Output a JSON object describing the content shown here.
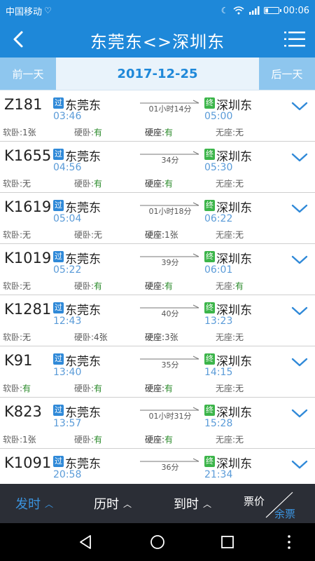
{
  "status": {
    "carrier": "中国移动",
    "time": "00:06"
  },
  "header": {
    "title": "东莞东<>深圳东"
  },
  "datebar": {
    "prev_label": "前一天",
    "date": "2017-12-25",
    "next_label": "后一天"
  },
  "trains": [
    {
      "num": "Z181",
      "from": "东莞东",
      "dep": "03:46",
      "duration": "01小时14分",
      "to": "深圳东",
      "arr": "05:00",
      "seats": [
        {
          "label": "软卧:",
          "val": "1张",
          "avail": false
        },
        {
          "label": "硬卧:",
          "val": "有",
          "avail": true
        },
        {
          "label": "硬座:",
          "val": "有",
          "avail": true
        },
        {
          "label": "无座:",
          "val": "无",
          "avail": false
        }
      ]
    },
    {
      "num": "K1655",
      "from": "东莞东",
      "dep": "04:56",
      "duration": "34分",
      "to": "深圳东",
      "arr": "05:30",
      "seats": [
        {
          "label": "软卧:",
          "val": "无",
          "avail": false
        },
        {
          "label": "硬卧:",
          "val": "有",
          "avail": true
        },
        {
          "label": "硬座:",
          "val": "有",
          "avail": true
        },
        {
          "label": "无座:",
          "val": "无",
          "avail": false
        }
      ]
    },
    {
      "num": "K1619",
      "from": "东莞东",
      "dep": "05:04",
      "duration": "01小时18分",
      "to": "深圳东",
      "arr": "06:22",
      "seats": [
        {
          "label": "软卧:",
          "val": "无",
          "avail": false
        },
        {
          "label": "硬卧:",
          "val": "无",
          "avail": false
        },
        {
          "label": "硬座:",
          "val": "1张",
          "avail": false
        },
        {
          "label": "无座:",
          "val": "无",
          "avail": false
        }
      ]
    },
    {
      "num": "K1019",
      "from": "东莞东",
      "dep": "05:22",
      "duration": "39分",
      "to": "深圳东",
      "arr": "06:01",
      "seats": [
        {
          "label": "软卧:",
          "val": "无",
          "avail": false
        },
        {
          "label": "硬卧:",
          "val": "有",
          "avail": true
        },
        {
          "label": "硬座:",
          "val": "有",
          "avail": true
        },
        {
          "label": "无座:",
          "val": "有",
          "avail": true
        }
      ]
    },
    {
      "num": "K1281",
      "from": "东莞东",
      "dep": "12:43",
      "duration": "40分",
      "to": "深圳东",
      "arr": "13:23",
      "seats": [
        {
          "label": "软卧:",
          "val": "无",
          "avail": false
        },
        {
          "label": "硬卧:",
          "val": "4张",
          "avail": false
        },
        {
          "label": "硬座:",
          "val": "3张",
          "avail": false
        },
        {
          "label": "无座:",
          "val": "无",
          "avail": false
        }
      ]
    },
    {
      "num": "K91",
      "from": "东莞东",
      "dep": "13:40",
      "duration": "35分",
      "to": "深圳东",
      "arr": "14:15",
      "seats": [
        {
          "label": "软卧:",
          "val": "有",
          "avail": true
        },
        {
          "label": "硬卧:",
          "val": "有",
          "avail": true
        },
        {
          "label": "硬座:",
          "val": "有",
          "avail": true
        },
        {
          "label": "无座:",
          "val": "无",
          "avail": false
        }
      ]
    },
    {
      "num": "K823",
      "from": "东莞东",
      "dep": "13:57",
      "duration": "01小时31分",
      "to": "深圳东",
      "arr": "15:28",
      "seats": [
        {
          "label": "软卧:",
          "val": "1张",
          "avail": false
        },
        {
          "label": "硬卧:",
          "val": "有",
          "avail": true
        },
        {
          "label": "硬座:",
          "val": "有",
          "avail": true
        },
        {
          "label": "无座:",
          "val": "无",
          "avail": false
        }
      ]
    },
    {
      "num": "K1091",
      "from": "东莞东",
      "dep": "20:58",
      "duration": "36分",
      "to": "深圳东",
      "arr": "21:34",
      "seats": [
        {
          "label": "软卧:",
          "val": "无",
          "avail": false
        },
        {
          "label": "硬卧:",
          "val": "有",
          "avail": true
        },
        {
          "label": "硬座:",
          "val": "有",
          "avail": true
        },
        {
          "label": "无座:",
          "val": "无",
          "avail": false
        }
      ]
    }
  ],
  "badges": {
    "pass": "过",
    "terminal": "终"
  },
  "bottom": {
    "tabs": [
      {
        "label": "发时",
        "active": true
      },
      {
        "label": "历时",
        "active": false
      },
      {
        "label": "到时",
        "active": false
      }
    ],
    "price_label": "票价",
    "ticket_label": "余票"
  },
  "colors": {
    "primary": "#1e88d9",
    "pass_badge": "#2f89d8",
    "terminal_badge": "#3cb54a",
    "available": "#2a8a2a",
    "time": "#5a9bd8",
    "bottom_bar": "#2b2e36"
  },
  "icons": {
    "back": "chevron-left-icon",
    "menu": "list-menu-icon",
    "expand": "chevron-down-icon",
    "nav_back": "triangle-back-icon",
    "nav_home": "circle-home-icon",
    "nav_recent": "square-recent-icon"
  }
}
